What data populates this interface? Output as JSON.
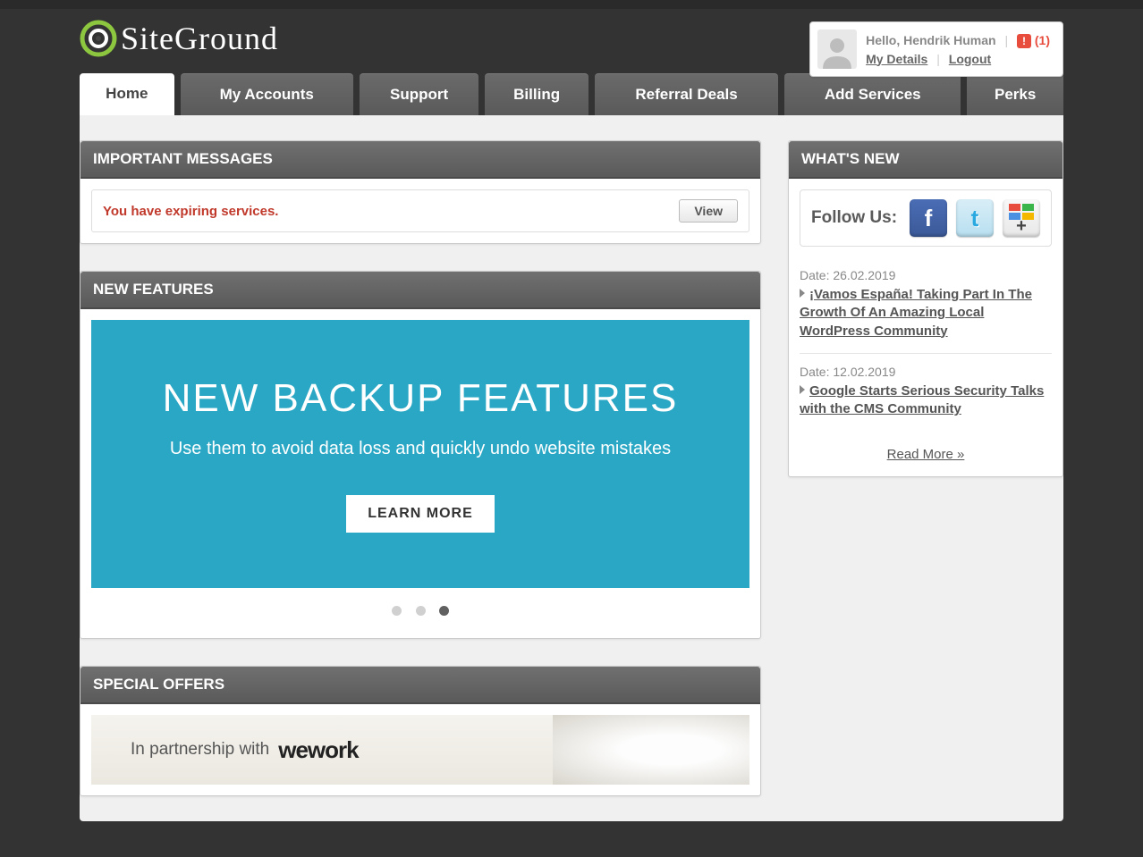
{
  "brand": {
    "name": "SiteGround"
  },
  "user": {
    "greeting": "Hello, Hendrik Human",
    "alert_count": "(1)",
    "my_details": "My Details",
    "logout": "Logout"
  },
  "nav": {
    "tabs": [
      {
        "label": "Home",
        "active": true
      },
      {
        "label": "My Accounts",
        "active": false
      },
      {
        "label": "Support",
        "active": false
      },
      {
        "label": "Billing",
        "active": false
      },
      {
        "label": "Referral Deals",
        "active": false
      },
      {
        "label": "Add Services",
        "active": false
      },
      {
        "label": "Perks",
        "active": false
      }
    ]
  },
  "important": {
    "header": "IMPORTANT MESSAGES",
    "message": "You have expiring services.",
    "view_btn": "View"
  },
  "features": {
    "header": "NEW FEATURES",
    "banner_title": "New Backup Features",
    "banner_sub": "Use them to avoid data loss and quickly undo website mistakes",
    "learn_more": "LEARN MORE",
    "active_dot": 2
  },
  "offers": {
    "header": "SPECIAL OFFERS",
    "partnership_text": "In partnership with",
    "partner_name": "wework"
  },
  "whatsnew": {
    "header": "WHAT'S NEW",
    "follow_label": "Follow Us:",
    "read_more": "Read More »",
    "items": [
      {
        "date": "Date: 26.02.2019",
        "title": "¡Vamos España! Taking Part In The Growth Of An Amazing Local WordPress Community"
      },
      {
        "date": "Date: 12.02.2019",
        "title": "Google Starts Serious Security Talks with the CMS Community"
      }
    ]
  }
}
